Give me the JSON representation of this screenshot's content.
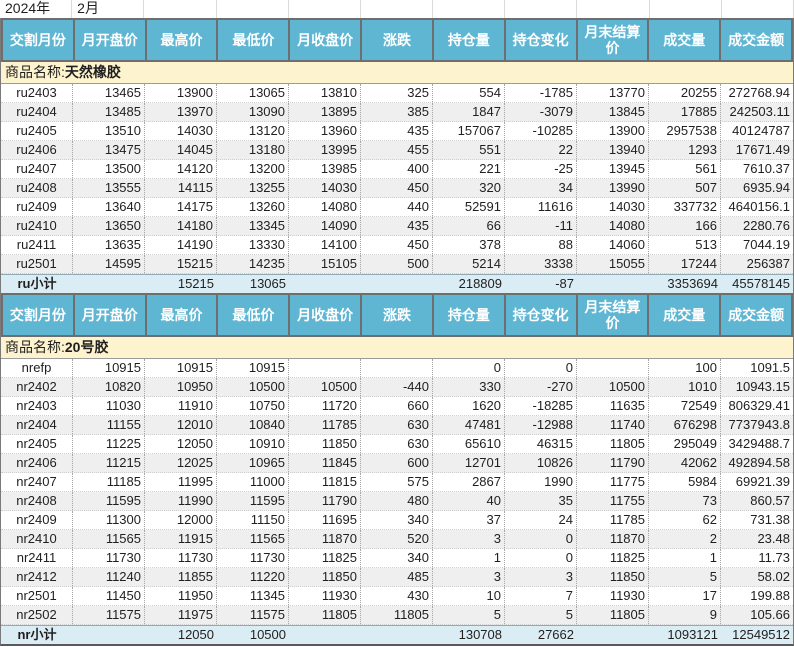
{
  "meta": {
    "year_label": "2024年",
    "month_label": "2月"
  },
  "columns": [
    "交割月份",
    "月开盘价",
    "最高价",
    "最低价",
    "月收盘价",
    "涨跌",
    "持仓量",
    "持仓变化",
    "月末结算价",
    "成交量",
    "成交金额"
  ],
  "colors": {
    "header_bg": "#5fb6d3",
    "header_border": "#6e6e6e",
    "section_band_bg": "#fdf3ce",
    "stripe_bg": "#efefef",
    "subtotal_bg": "#dbedf4",
    "text": "#1f1f1f"
  },
  "sections": [
    {
      "title_prefix": "商品名称:",
      "title_name": "天然橡胶",
      "rows": [
        [
          "ru2403",
          "13465",
          "13900",
          "13065",
          "13810",
          "325",
          "554",
          "-1785",
          "13770",
          "20255",
          "272768.94"
        ],
        [
          "ru2404",
          "13485",
          "13970",
          "13090",
          "13895",
          "385",
          "1847",
          "-3079",
          "13845",
          "17885",
          "242503.11"
        ],
        [
          "ru2405",
          "13510",
          "14030",
          "13120",
          "13960",
          "435",
          "157067",
          "-10285",
          "13900",
          "2957538",
          "40124787"
        ],
        [
          "ru2406",
          "13475",
          "14045",
          "13180",
          "13995",
          "455",
          "551",
          "22",
          "13940",
          "1293",
          "17671.49"
        ],
        [
          "ru2407",
          "13500",
          "14120",
          "13200",
          "13985",
          "400",
          "221",
          "-25",
          "13945",
          "561",
          "7610.37"
        ],
        [
          "ru2408",
          "13555",
          "14115",
          "13255",
          "14030",
          "450",
          "320",
          "34",
          "13990",
          "507",
          "6935.94"
        ],
        [
          "ru2409",
          "13640",
          "14175",
          "13260",
          "14080",
          "440",
          "52591",
          "11616",
          "14030",
          "337732",
          "4640156.1"
        ],
        [
          "ru2410",
          "13650",
          "14180",
          "13345",
          "14090",
          "435",
          "66",
          "-11",
          "14080",
          "166",
          "2280.76"
        ],
        [
          "ru2411",
          "13635",
          "14190",
          "13330",
          "14100",
          "450",
          "378",
          "88",
          "14060",
          "513",
          "7044.19"
        ],
        [
          "ru2501",
          "14595",
          "15215",
          "14235",
          "15105",
          "500",
          "5214",
          "3338",
          "15055",
          "17244",
          "256387"
        ]
      ],
      "subtotal": [
        "ru小计",
        "",
        "15215",
        "13065",
        "",
        "",
        "218809",
        "-87",
        "",
        "3353694",
        "45578145"
      ]
    },
    {
      "title_prefix": "商品名称:",
      "title_name": "20号胶",
      "rows": [
        [
          "nrefp",
          "10915",
          "10915",
          "10915",
          "",
          "",
          "0",
          "0",
          "",
          "100",
          "1091.5"
        ],
        [
          "nr2402",
          "10820",
          "10950",
          "10500",
          "10500",
          "-440",
          "330",
          "-270",
          "10500",
          "1010",
          "10943.15"
        ],
        [
          "nr2403",
          "11030",
          "11910",
          "10750",
          "11720",
          "660",
          "1620",
          "-18285",
          "11635",
          "72549",
          "806329.41"
        ],
        [
          "nr2404",
          "11155",
          "12010",
          "10840",
          "11785",
          "630",
          "47481",
          "-12988",
          "11740",
          "676298",
          "7737943.8"
        ],
        [
          "nr2405",
          "11225",
          "12050",
          "10910",
          "11850",
          "630",
          "65610",
          "46315",
          "11805",
          "295049",
          "3429488.7"
        ],
        [
          "nr2406",
          "11215",
          "12025",
          "10965",
          "11845",
          "600",
          "12701",
          "10826",
          "11790",
          "42062",
          "492894.58"
        ],
        [
          "nr2407",
          "11185",
          "11995",
          "11000",
          "11815",
          "575",
          "2867",
          "1990",
          "11775",
          "5984",
          "69921.39"
        ],
        [
          "nr2408",
          "11595",
          "11990",
          "11595",
          "11790",
          "480",
          "40",
          "35",
          "11755",
          "73",
          "860.57"
        ],
        [
          "nr2409",
          "11300",
          "12000",
          "11150",
          "11695",
          "340",
          "37",
          "24",
          "11785",
          "62",
          "731.38"
        ],
        [
          "nr2410",
          "11565",
          "11915",
          "11565",
          "11870",
          "520",
          "3",
          "0",
          "11870",
          "2",
          "23.48"
        ],
        [
          "nr2411",
          "11730",
          "11730",
          "11730",
          "11825",
          "340",
          "1",
          "0",
          "11825",
          "1",
          "11.73"
        ],
        [
          "nr2412",
          "11240",
          "11855",
          "11220",
          "11850",
          "485",
          "3",
          "3",
          "11850",
          "5",
          "58.02"
        ],
        [
          "nr2501",
          "11450",
          "11950",
          "11345",
          "11930",
          "430",
          "10",
          "7",
          "11930",
          "17",
          "199.88"
        ],
        [
          "nr2502",
          "11575",
          "11975",
          "11575",
          "11805",
          "11805",
          "5",
          "5",
          "11805",
          "9",
          "105.66"
        ]
      ],
      "subtotal": [
        "nr小计",
        "",
        "12050",
        "10500",
        "",
        "",
        "130708",
        "27662",
        "",
        "1093121",
        "12549512"
      ]
    }
  ]
}
